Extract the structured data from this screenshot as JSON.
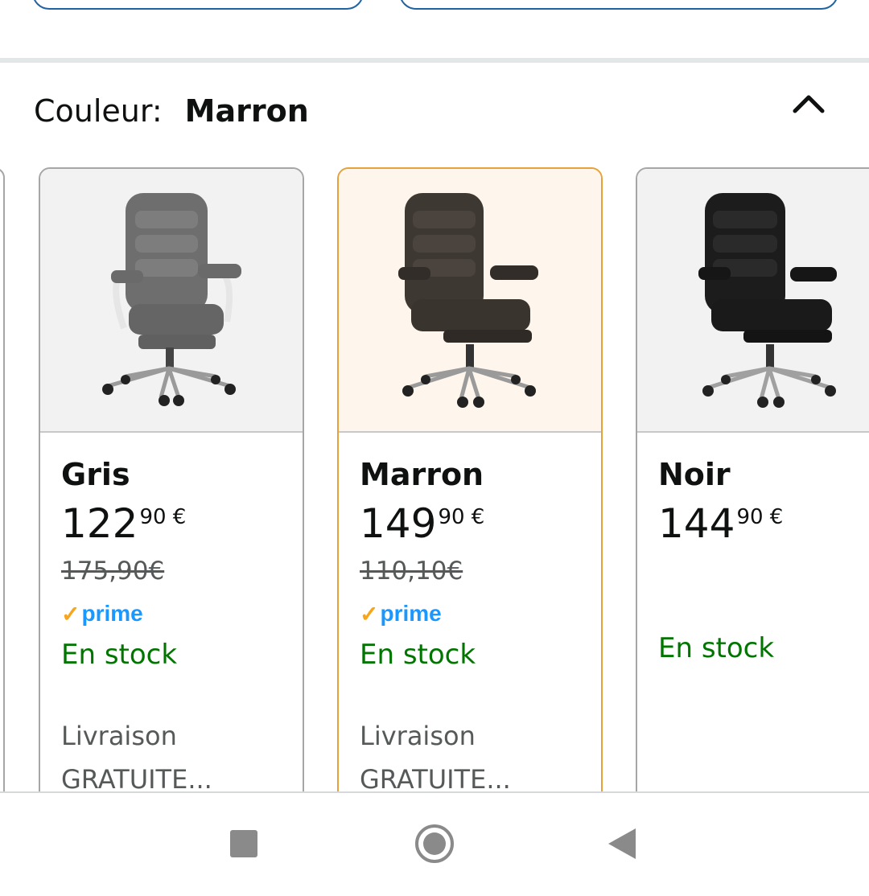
{
  "variation": {
    "label": "Couleur:",
    "selected_value": "Marron"
  },
  "icons": {
    "collapse": "chevron-up-icon"
  },
  "colors": {
    "in_stock": "#007600",
    "selected_border": "#e7a13b",
    "prime_blue": "#1a98ff",
    "prime_check": "#f7a51a"
  },
  "cards": [
    {
      "name": "Gris",
      "price_whole": "122",
      "price_fraction": "90 €",
      "old_price": "175,90€",
      "prime": "prime",
      "stock": "En stock",
      "delivery_line1": "Livraison",
      "delivery_line2": "GRATUITE..."
    },
    {
      "name": "Marron",
      "price_whole": "149",
      "price_fraction": "90 €",
      "old_price": "110,10€",
      "prime": "prime",
      "stock": "En stock",
      "delivery_line1": "Livraison",
      "delivery_line2": "GRATUITE..."
    },
    {
      "name": "Noir",
      "price_whole": "144",
      "price_fraction": "90 €",
      "stock": "En stock"
    }
  ],
  "navbar": {
    "recents": "square-icon",
    "home": "circle-home-icon",
    "back": "triangle-back-icon"
  }
}
